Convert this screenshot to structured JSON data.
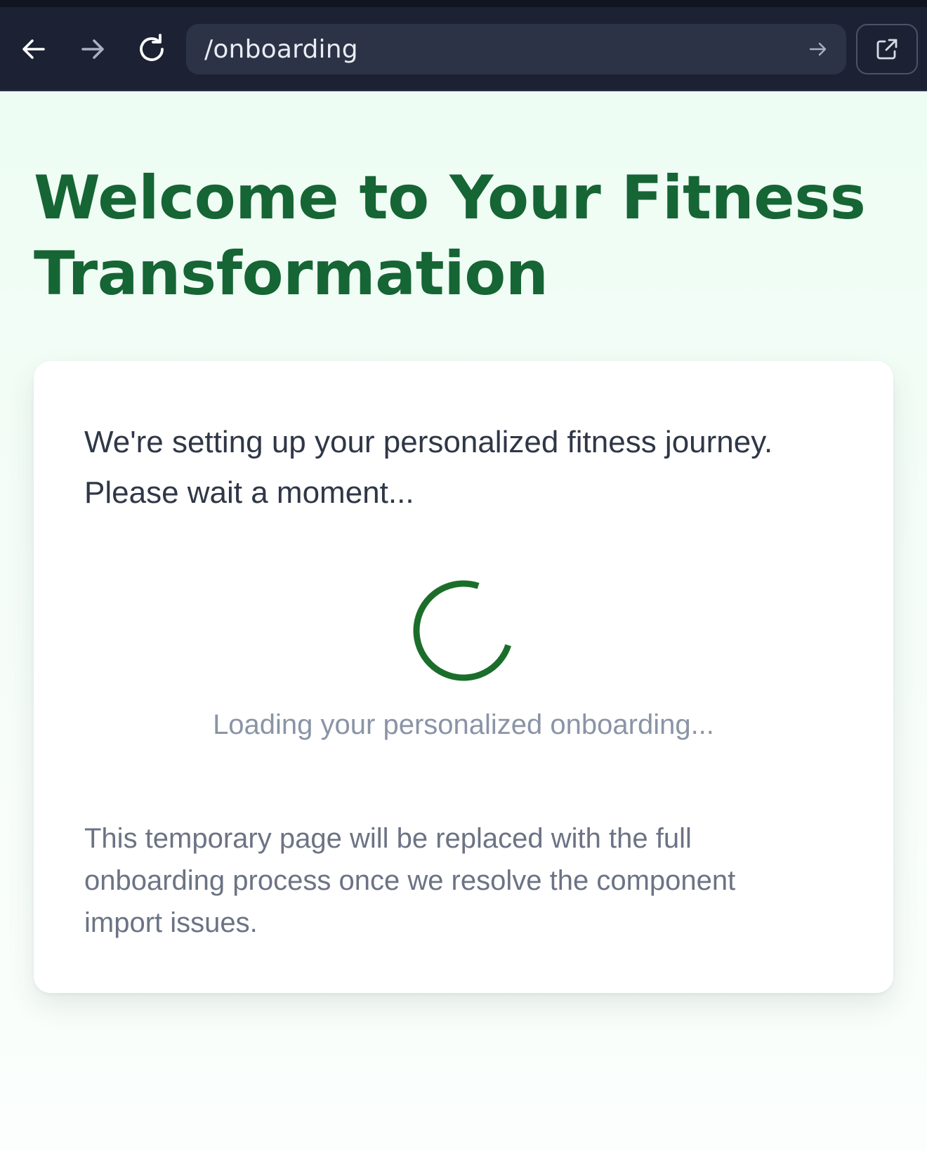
{
  "browser": {
    "url": "/onboarding",
    "icons": {
      "back": "arrow-left-icon",
      "forward": "arrow-right-icon",
      "reload": "reload-icon",
      "go": "arrow-right-icon",
      "open_external": "external-link-icon"
    }
  },
  "page": {
    "title": "Welcome to Your Fitness Transformation",
    "intro": "We're setting up your personalized fitness journey. Please wait a moment...",
    "loading_text": "Loading your personalized onboarding...",
    "note": "This temporary page will be replaced with the full onboarding process once we resolve the component import issues."
  },
  "colors": {
    "toolbar_bg": "#1c2233",
    "title": "#166534",
    "spinner": "#1b6e2a",
    "page_bg": "#ecfdf3"
  }
}
